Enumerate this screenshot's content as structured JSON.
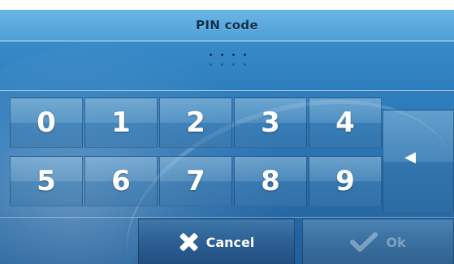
{
  "dialog": {
    "title": "PIN code"
  },
  "pin": {
    "dots_row1": 4,
    "dots_row2": 4
  },
  "keypad": {
    "keys": [
      "0",
      "1",
      "2",
      "3",
      "4",
      "5",
      "6",
      "7",
      "8",
      "9"
    ],
    "backspace_glyph": "◀"
  },
  "buttons": {
    "cancel_label": "Cancel",
    "ok_label": "Ok",
    "ok_enabled": false
  },
  "colors": {
    "background": "#2e7fbf",
    "title_text": "#0e2f4f",
    "key_text": "#ffffff"
  }
}
